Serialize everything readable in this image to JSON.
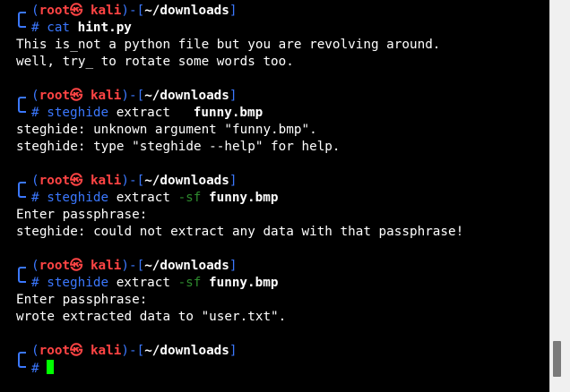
{
  "prompt": {
    "user": "root",
    "skull": "㉿",
    "host": "kali",
    "dir": "~/downloads",
    "symbol": "#"
  },
  "blocks": [
    {
      "command": [
        {
          "text": "cat",
          "style": "blue"
        },
        {
          "text": " ",
          "style": "plain"
        },
        {
          "text": "hint.py",
          "style": "bold"
        }
      ],
      "output": [
        "This is_not a python file but you are revolving around.",
        "well, try_ to rotate some words too."
      ]
    },
    {
      "command": [
        {
          "text": "steghide",
          "style": "blue"
        },
        {
          "text": " extract   ",
          "style": "plain"
        },
        {
          "text": "funny.bmp",
          "style": "bold"
        }
      ],
      "output": [
        "steghide: unknown argument \"funny.bmp\".",
        "steghide: type \"steghide --help\" for help."
      ]
    },
    {
      "command": [
        {
          "text": "steghide",
          "style": "blue"
        },
        {
          "text": " extract ",
          "style": "plain"
        },
        {
          "text": "-sf",
          "style": "opt"
        },
        {
          "text": " ",
          "style": "plain"
        },
        {
          "text": "funny.bmp",
          "style": "bold"
        }
      ],
      "output": [
        "Enter passphrase:",
        "steghide: could not extract any data with that passphrase!"
      ]
    },
    {
      "command": [
        {
          "text": "steghide",
          "style": "blue"
        },
        {
          "text": " extract ",
          "style": "plain"
        },
        {
          "text": "-sf",
          "style": "opt"
        },
        {
          "text": " ",
          "style": "plain"
        },
        {
          "text": "funny.bmp",
          "style": "bold"
        }
      ],
      "output": [
        "Enter passphrase:",
        "wrote extracted data to \"user.txt\"."
      ]
    },
    {
      "command": [],
      "output": []
    }
  ]
}
